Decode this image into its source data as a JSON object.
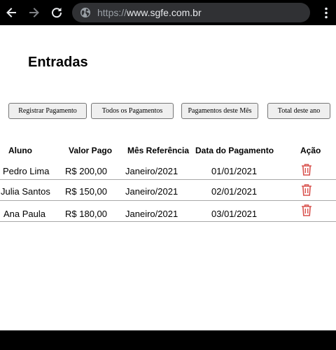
{
  "browser": {
    "url_scheme": "https://",
    "url_host": "www.sgfe.com.br"
  },
  "page": {
    "title": "Entradas"
  },
  "buttons": {
    "register": "Registrar Pagamento",
    "all": "Todos os Pagamentos",
    "this_month": "Pagamentos deste Mês",
    "year_total": "Total deste ano"
  },
  "table": {
    "headers": {
      "student": "Aluno",
      "amount": "Valor Pago",
      "ref_month": "Mês Referência",
      "pay_date": "Data do Pagamento",
      "action": "Ação"
    },
    "rows": [
      {
        "student": "Pedro Lima",
        "amount": "R$ 200,00",
        "ref_month": "Janeiro/2021",
        "pay_date": "01/01/2021",
        "action_icon": "trash-icon"
      },
      {
        "student": "Julia Santos",
        "amount": "R$ 150,00",
        "ref_month": "Janeiro/2021",
        "pay_date": "02/01/2021",
        "action_icon": "trash-icon"
      },
      {
        "student": "Ana Paula",
        "amount": "R$ 180,00",
        "ref_month": "Janeiro/2021",
        "pay_date": "03/01/2021",
        "action_icon": "trash-icon"
      }
    ]
  },
  "colors": {
    "delete_icon": "#d9534f",
    "chrome_bg": "#000000",
    "omnibox_bg": "#303134"
  }
}
